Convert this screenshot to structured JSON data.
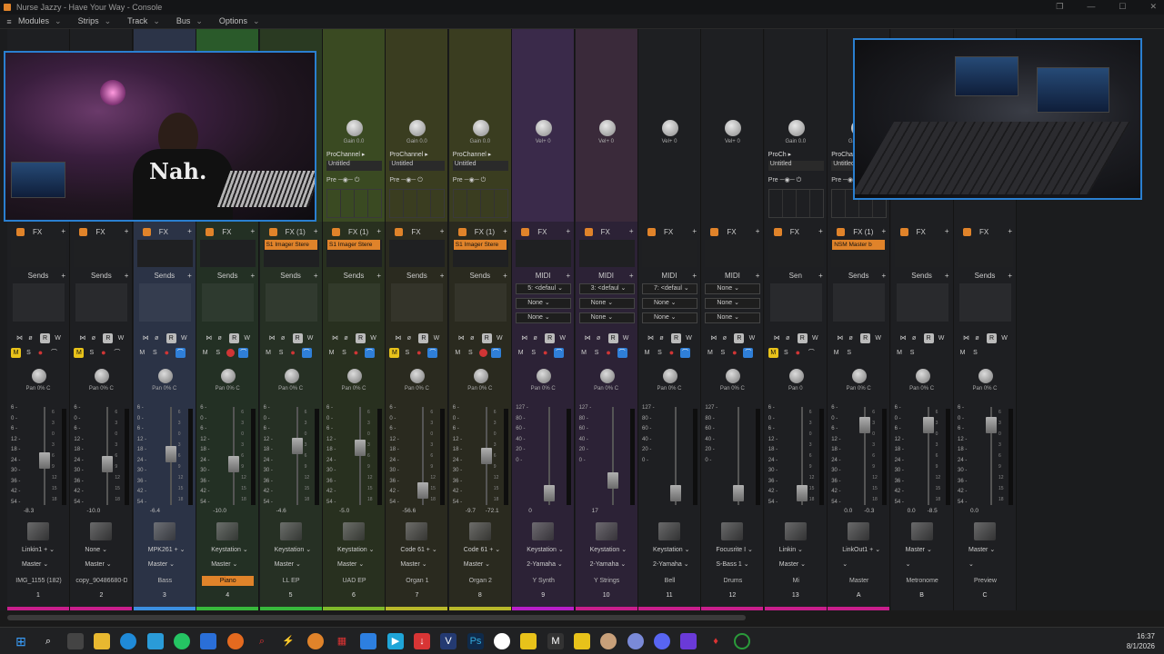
{
  "window": {
    "title": "Nurse Jazzy - Have Your Way - Console"
  },
  "menu": [
    "Modules",
    "Strips",
    "Track",
    "Bus",
    "Options"
  ],
  "strips": [
    {
      "bg": "#1e1f22",
      "topbg": "#1e1f22",
      "fx": "FX",
      "sends": "Sends",
      "btns": "std",
      "m_on": true,
      "pan": "Pan 0% C",
      "vals": [
        "-8.3",
        ""
      ],
      "input": "Linkin1 +",
      "output": "Master",
      "name": "IMG_1155 (182)",
      "num": "1",
      "color": "#c81e8c",
      "fader": 0.55
    },
    {
      "bg": "#1e1f22",
      "topbg": "#1e1f22",
      "fx": "FX",
      "sends": "Sends",
      "btns": "std",
      "m_on": true,
      "pan": "Pan 0% C",
      "vals": [
        "-10.0",
        ""
      ],
      "input": "None",
      "output": "Master",
      "name": "copy_90486680-D",
      "num": "2",
      "color": "#c81e8c",
      "fader": 0.6
    },
    {
      "bg": "#2b3346",
      "topbg": "#2c3448",
      "fx": "FX",
      "sends": "Sends",
      "btns": "mon",
      "pan": "Pan 0% C",
      "vals": [
        "-6.4",
        ""
      ],
      "input": "MPK261 +",
      "output": "Master",
      "name": "Bass",
      "num": "3",
      "color": "#3c8fe0",
      "fader": 0.48
    },
    {
      "bg": "#233024",
      "topbg": "#2a5a2a",
      "fx": "FX",
      "sends": "Sends",
      "btns": "rec",
      "pan": "Pan 0% C",
      "vals": [
        "-10.0",
        ""
      ],
      "input": "Keystation",
      "output": "Master",
      "name": "Piano",
      "name_hl": true,
      "num": "4",
      "color": "#38b83c",
      "fader": 0.6
    },
    {
      "bg": "#263024",
      "topbg": "#2a3a22",
      "fx": "FX (1)",
      "chip": "S1 Imager Stere",
      "sends": "Sends",
      "btns": "mon",
      "pan": "Pan 0% C",
      "vals": [
        "-4.6",
        ""
      ],
      "input": "Keystation",
      "output": "Master",
      "name": "LL EP",
      "num": "5",
      "color": "#38b83c",
      "fader": 0.38
    },
    {
      "bg": "#28301f",
      "topbg": "#3a4a22",
      "fx": "FX (1)",
      "chip": "S1 Imager Stere",
      "sends": "Sends",
      "btns": "mon",
      "pan": "Pan 0% C",
      "vals": [
        "-5.0",
        ""
      ],
      "input": "Keystation",
      "output": "Master",
      "name": "UAD EP",
      "num": "6",
      "color": "#7fb82a",
      "fader": 0.4,
      "gain": "Gain 0.0",
      "pc": "ProChannel",
      "untitled": "Untitled",
      "pre": "Pre"
    },
    {
      "bg": "#2a2a1f",
      "topbg": "#3a3d20",
      "fx": "FX",
      "sends": "Sends",
      "btns": "mon",
      "m_on": true,
      "pan": "Pan 0% C",
      "vals": [
        "-56.6",
        ""
      ],
      "input": "Code 61 +",
      "output": "Master",
      "name": "Organ 1",
      "num": "7",
      "color": "#b8b82a",
      "fader": 0.92,
      "gain": "Gain 0.0",
      "pc": "ProChannel",
      "untitled": "Untitled",
      "pre": "Pre"
    },
    {
      "bg": "#2a2a1f",
      "topbg": "#3a3d20",
      "fx": "FX (1)",
      "chip": "S1 Imager Stere",
      "sends": "Sends",
      "btns": "rec",
      "pan": "Pan 0% C",
      "vals": [
        "-9.7",
        "-72.1"
      ],
      "input": "Code 61 +",
      "output": "Master",
      "name": "Organ 2",
      "num": "8",
      "color": "#b8b82a",
      "fader": 0.5,
      "gain": "Gain 0.0",
      "pc": "ProChannel",
      "untitled": "Untitled",
      "pre": "Pre"
    },
    {
      "bg": "#2c2236",
      "topbg": "#3a2a4a",
      "fx": "FX",
      "sends": "MIDI",
      "midi": [
        "5: <defaul",
        "None",
        "None"
      ],
      "btns": "midi",
      "pan": "Pan 0% C",
      "vals": [
        "0",
        ""
      ],
      "input": "Keystation",
      "output": "2-Yamaha",
      "name": "Y Synth",
      "num": "9",
      "color": "#b81ec8",
      "fader": 0.95,
      "gain": "Vel+ 0"
    },
    {
      "bg": "#2c2236",
      "topbg": "#3a2a3a",
      "fx": "FX",
      "sends": "MIDI",
      "midi": [
        "3: <defaul",
        "None",
        "None"
      ],
      "btns": "midi",
      "pan": "Pan 0% C",
      "vals": [
        "17",
        ""
      ],
      "input": "Keystation",
      "output": "2-Yamaha",
      "name": "Y Strings",
      "num": "10",
      "color": "#c81e8c",
      "fader": 0.8,
      "gain": "Vel+ 0"
    },
    {
      "bg": "#1e1f22",
      "topbg": "#1e1f22",
      "fx": "FX",
      "sends": "MIDI",
      "midi": [
        "7: <defaul",
        "None",
        "None"
      ],
      "btns": "midi",
      "pan": "Pan 0% C",
      "vals": [
        "",
        ""
      ],
      "input": "Keystation",
      "output": "2-Yamaha",
      "name": "Bell",
      "num": "11",
      "color": "#c81e8c",
      "fader": 0.95,
      "gain": "Vel+ 0"
    },
    {
      "bg": "#1e1f22",
      "topbg": "#1e1f22",
      "fx": "FX",
      "sends": "MIDI",
      "midi": [
        "None",
        "None",
        "None"
      ],
      "btns": "midi",
      "pan": "Pan 0% C",
      "vals": [
        "",
        ""
      ],
      "input": "Focusrite I",
      "output": "S-Bass 1",
      "name": "Drums",
      "num": "12",
      "color": "#c81e8c",
      "fader": 0.95,
      "gain": "Vel+ 0"
    },
    {
      "bg": "#1e1f22",
      "topbg": "#1e1f22",
      "fx": "FX",
      "sends": "Sen",
      "btns": "std",
      "m_on": true,
      "pan": "Pan 0",
      "vals": [
        "",
        ""
      ],
      "input": "Linkin",
      "output": "Master",
      "name": "Mi",
      "num": "13",
      "color": "#c81e8c",
      "fader": 0.95,
      "gain": "Gain 0.0",
      "pc": "ProCh",
      "untitled": "Untitled",
      "pre": "Pre"
    },
    {
      "bg": "#1e1f22",
      "topbg": "#1e1f22",
      "fx": "FX (1)",
      "chip": "NSM Master b",
      "sends": "Sends",
      "btns": "bus",
      "pan": "Pan 0% C",
      "vals": [
        "0.0",
        "-0.3"
      ],
      "input": "LinkOut1 +",
      "output": "",
      "name": "Master",
      "num": "A",
      "color": "#c81e8c",
      "fader": 0.12,
      "gain": "Gain 0.0",
      "pc": "ProChannel",
      "untitled": "Untitled",
      "pre": "Pre"
    },
    {
      "bg": "#1e1f22",
      "topbg": "#1e1f22",
      "fx": "FX",
      "sends": "Sends",
      "btns": "bus",
      "pan": "Pan 0% C",
      "vals": [
        "0.0",
        "-8.5"
      ],
      "input": "Master",
      "output": "",
      "name": "Metronome",
      "num": "B",
      "color": "#1e1f22",
      "fader": 0.12
    },
    {
      "bg": "#1e1f22",
      "topbg": "#1e1f22",
      "fx": "FX",
      "sends": "Sends",
      "btns": "bus",
      "pan": "Pan 0% C",
      "vals": [
        "0.0",
        ""
      ],
      "input": "Master",
      "output": "",
      "name": "Preview",
      "num": "C",
      "color": "#1e1f22",
      "fader": 0.12
    }
  ],
  "taskbar": {
    "time": "16:37",
    "date": "8/1/2026"
  }
}
